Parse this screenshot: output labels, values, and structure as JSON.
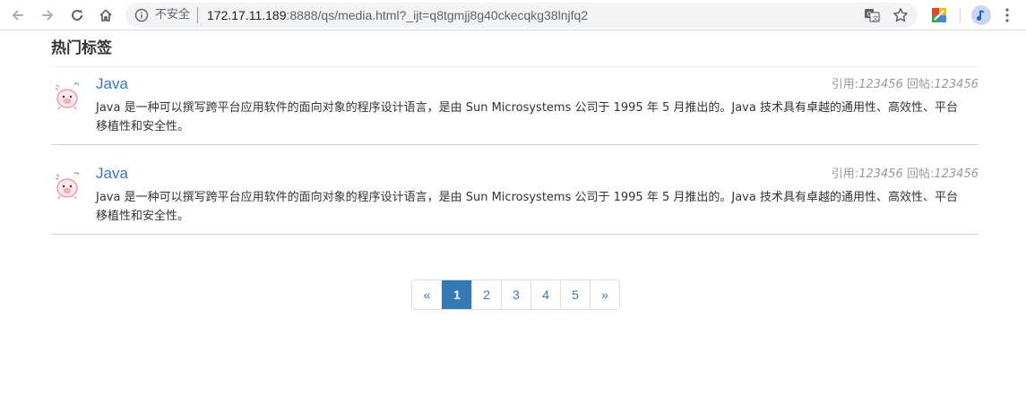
{
  "browser": {
    "security_label": "不安全",
    "url_host": "172.17.11.189",
    "url_path": ":8888/qs/media.html?_ijt=q8tgmjj8g40ckecqkg38lnjfq2"
  },
  "section": {
    "title": "热门标签"
  },
  "items": [
    {
      "title": "Java",
      "quote_label": "引用:",
      "quote_count": "123456",
      "reply_label": "回帖:",
      "reply_count": "123456",
      "description": "Java 是一种可以撰写跨平台应用软件的面向对象的程序设计语言，是由 Sun Microsystems 公司于 1995 年 5 月推出的。Java 技术具有卓越的通用性、高效性、平台移植性和安全性。"
    },
    {
      "title": "Java",
      "quote_label": "引用:",
      "quote_count": "123456",
      "reply_label": "回帖:",
      "reply_count": "123456",
      "description": "Java 是一种可以撰写跨平台应用软件的面向对象的程序设计语言，是由 Sun Microsystems 公司于 1995 年 5 月推出的。Java 技术具有卓越的通用性、高效性、平台移植性和安全性。"
    }
  ],
  "pagination": {
    "prev": "«",
    "pages": [
      "1",
      "2",
      "3",
      "4",
      "5"
    ],
    "next": "»",
    "active": "1"
  },
  "colors": {
    "link": "#337ab7",
    "muted": "#999999",
    "text": "#333333"
  }
}
